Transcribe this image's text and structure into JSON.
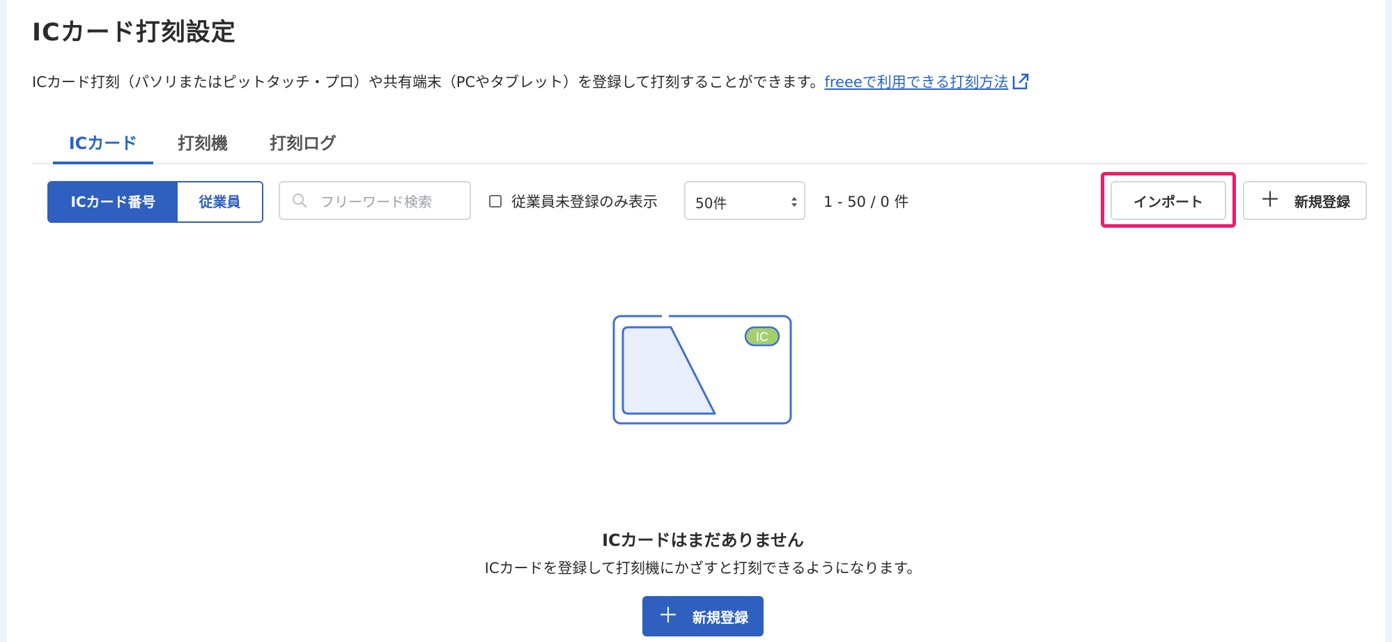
{
  "page": {
    "title": "ICカード打刻設定",
    "description": "ICカード打刻（パソリまたはピットタッチ・プロ）や共有端末（PCやタブレット）を登録して打刻することができます。",
    "help_link": "freeeで利用できる打刻方法"
  },
  "tabs": [
    {
      "label": "ICカード",
      "active": true
    },
    {
      "label": "打刻機",
      "active": false
    },
    {
      "label": "打刻ログ",
      "active": false
    }
  ],
  "toolbar": {
    "segment": {
      "options": [
        "ICカード番号",
        "従業員"
      ],
      "selected": "ICカード番号"
    },
    "search": {
      "placeholder": "フリーワード検索",
      "value": ""
    },
    "checkbox": {
      "label": "従業員未登録のみ表示",
      "checked": false
    },
    "per_page": {
      "selected": "50件"
    },
    "count_text": "1 - 50 / 0  件",
    "import_label": "インポート",
    "new_label": "新規登録"
  },
  "empty_state": {
    "card_badge": "IC",
    "title": "ICカードはまだありません",
    "description": "ICカードを登録して打刻機にかざすと打刻できるようになります。",
    "button_label": "新規登録"
  },
  "colors": {
    "accent": "#2f5fbf",
    "link": "#2864c8",
    "highlight": "#ee1c6a",
    "badge": "#a4cf6e"
  }
}
